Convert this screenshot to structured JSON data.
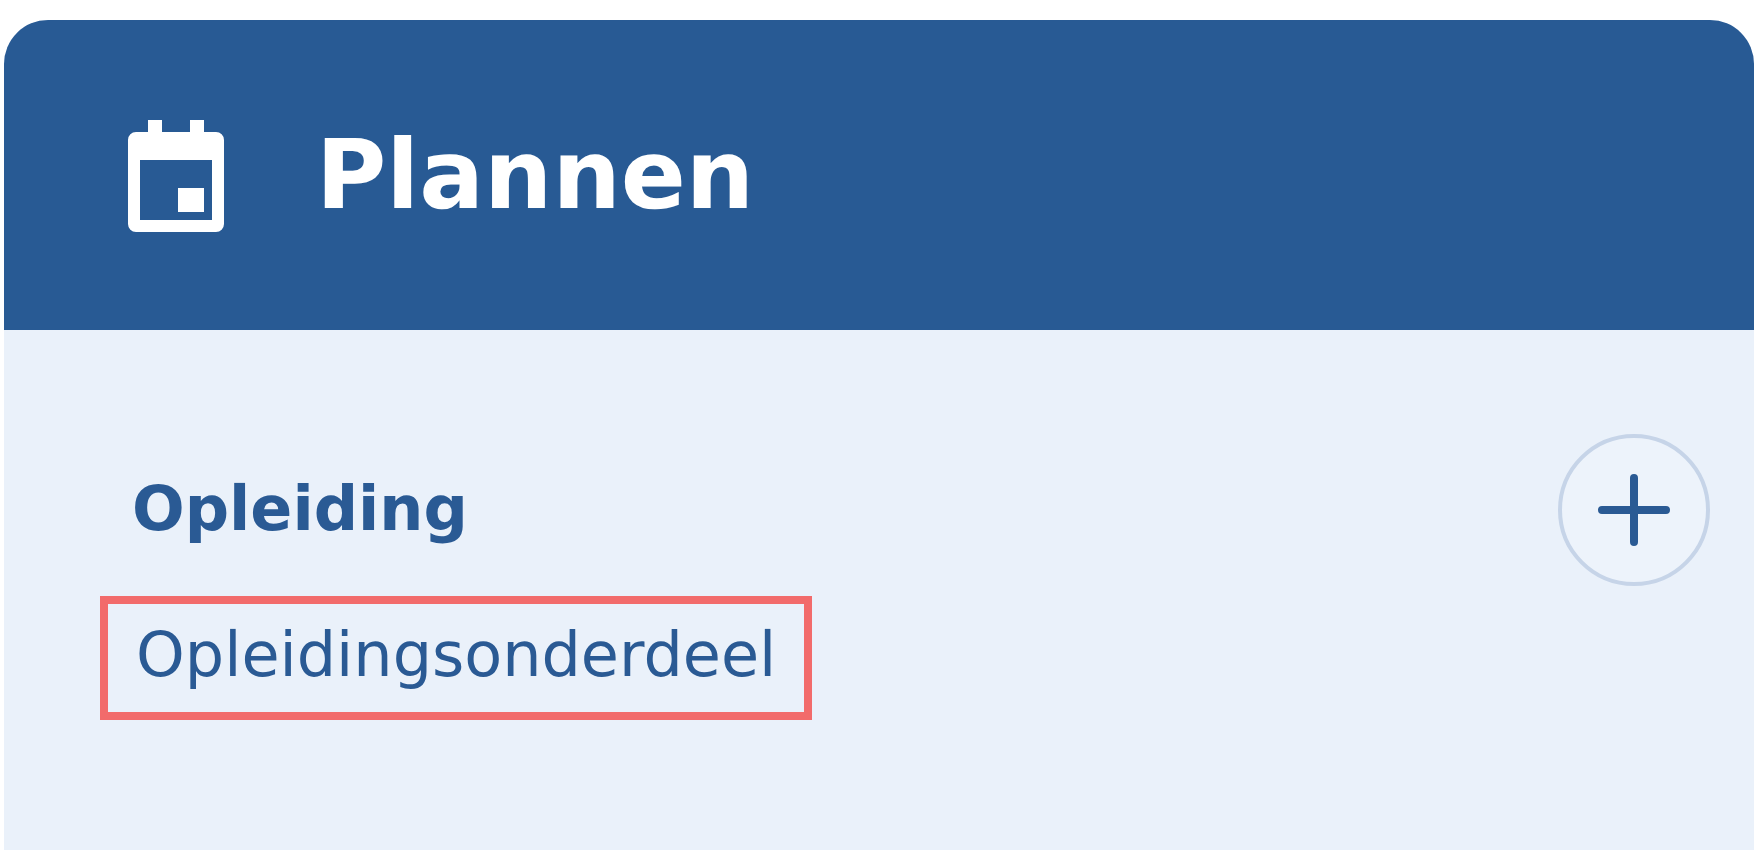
{
  "panel": {
    "title": "Plannen"
  },
  "section": {
    "title": "Opleiding"
  },
  "items": [
    {
      "label": "Opleidingsonderdeel",
      "highlighted": true
    }
  ]
}
